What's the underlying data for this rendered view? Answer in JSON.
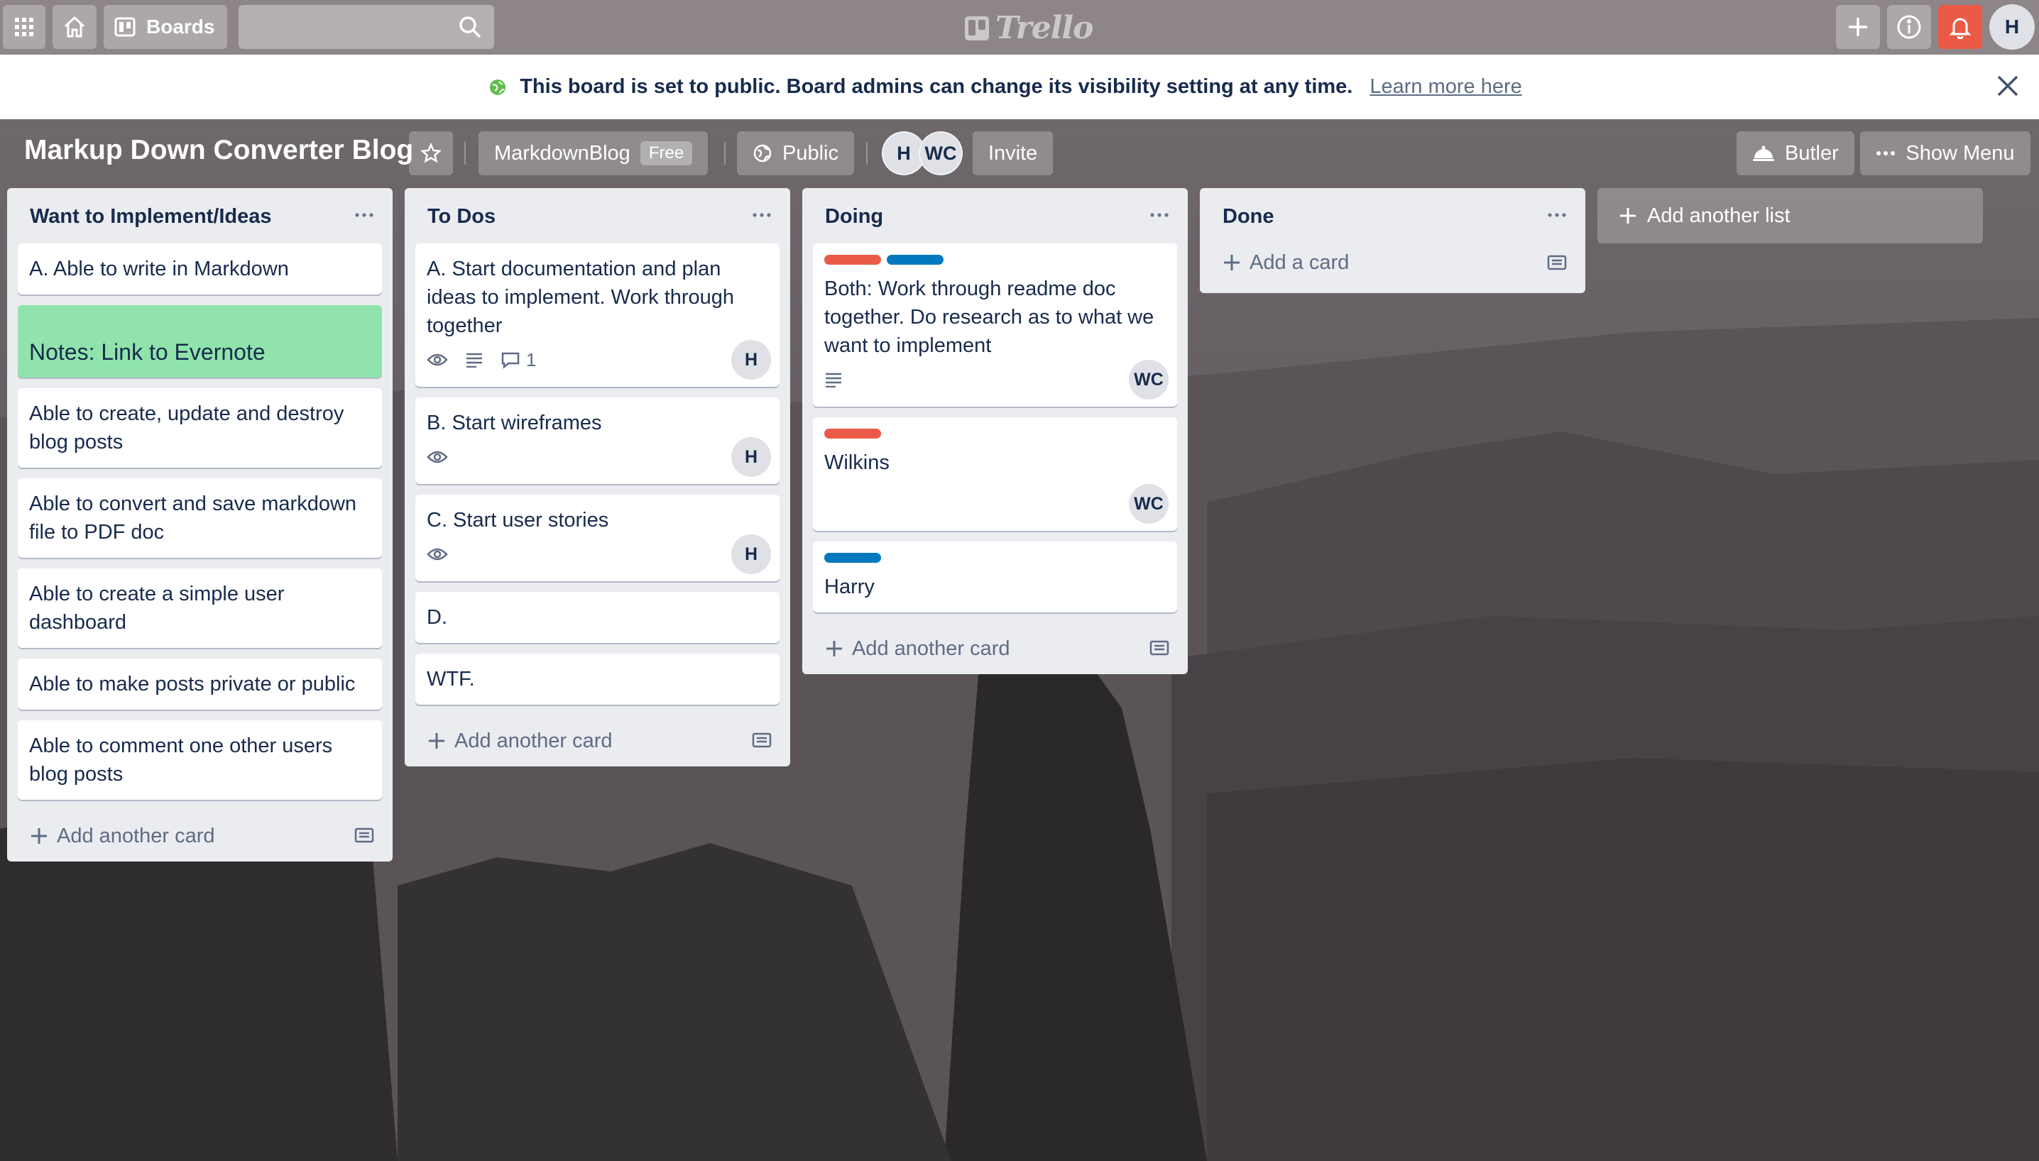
{
  "colors": {
    "nav_bg": "#8d8588",
    "list_bg": "#ebecf0",
    "label_red": "#eb5a46",
    "label_blue": "#0079bf",
    "green_card": "#90e4ab",
    "public_icon": "#61bd4f"
  },
  "nav": {
    "boards_label": "Boards",
    "logo_text": "Trello",
    "search_value": "",
    "user_initial": "H"
  },
  "banner": {
    "text": "This board is set to public. Board admins can change its visibility setting at any time.",
    "link": "Learn more here"
  },
  "board": {
    "title": "Markup Down Converter Blog",
    "team": "MarkdownBlog",
    "team_badge": "Free",
    "visibility": "Public",
    "members": [
      "H",
      "WC"
    ],
    "invite": "Invite",
    "butler": "Butler",
    "show_menu": "Show Menu",
    "add_list": "Add another list"
  },
  "lists": [
    {
      "title": "Want to Implement/Ideas",
      "add_label": "Add another card",
      "cards": [
        {
          "text": "A. Able to write in Markdown"
        },
        {
          "text": "Notes: Link to Evernote"
        },
        {
          "text": "Able to create, update and destroy blog posts"
        },
        {
          "text": "Able to convert and save markdown file to PDF doc"
        },
        {
          "text": "Able to create a simple user dashboard"
        },
        {
          "text": "Able to make posts private or public"
        },
        {
          "text": "Able to comment one other users blog posts"
        }
      ]
    },
    {
      "title": "To Dos",
      "add_label": "Add another card",
      "cards": [
        {
          "text": "A. Start documentation and plan ideas to implement. Work through together",
          "comments": "1",
          "member": "H"
        },
        {
          "text": "B. Start wireframes",
          "member": "H"
        },
        {
          "text": "C. Start user stories",
          "member": "H"
        },
        {
          "text": "D."
        },
        {
          "text": "WTF."
        }
      ]
    },
    {
      "title": "Doing",
      "add_label": "Add another card",
      "cards": [
        {
          "text": "Both: Work through readme doc together. Do research as to what we want to implement",
          "member": "WC"
        },
        {
          "text": "Wilkins",
          "member": "WC"
        },
        {
          "text": "Harry"
        }
      ]
    },
    {
      "title": "Done",
      "add_label": "Add a card",
      "cards": []
    }
  ]
}
